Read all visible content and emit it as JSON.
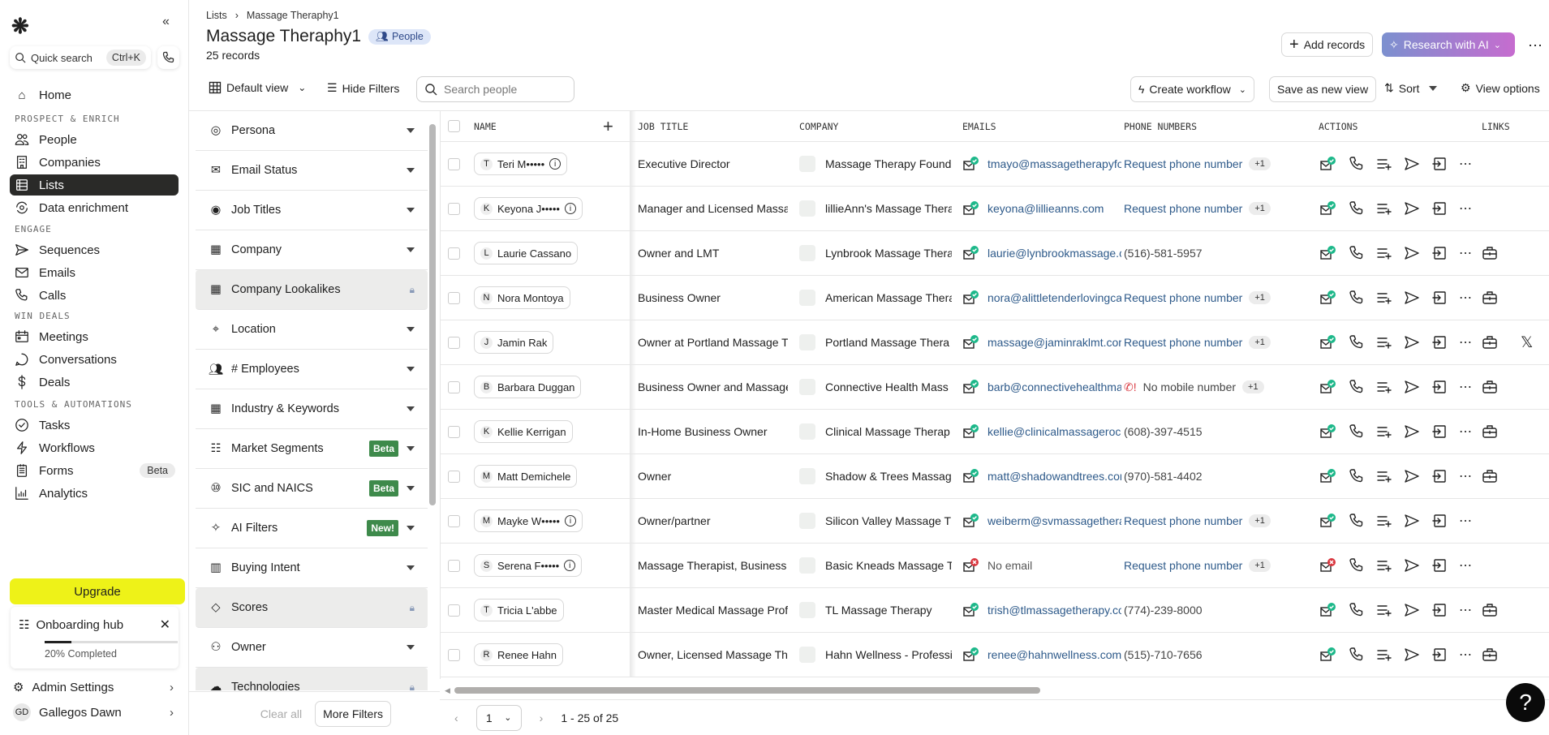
{
  "sidebar": {
    "quick_search": "Quick search",
    "shortcut": "Ctrl+K",
    "home": "Home",
    "sections": [
      {
        "label": "PROSPECT & ENRICH",
        "items": [
          {
            "label": "People",
            "icon": "people"
          },
          {
            "label": "Companies",
            "icon": "building"
          },
          {
            "label": "Lists",
            "icon": "list",
            "active": true
          },
          {
            "label": "Data enrichment",
            "icon": "refresh"
          }
        ]
      },
      {
        "label": "ENGAGE",
        "items": [
          {
            "label": "Sequences",
            "icon": "send"
          },
          {
            "label": "Emails",
            "icon": "mail"
          },
          {
            "label": "Calls",
            "icon": "phone"
          }
        ]
      },
      {
        "label": "WIN DEALS",
        "items": [
          {
            "label": "Meetings",
            "icon": "calendar"
          },
          {
            "label": "Conversations",
            "icon": "chat"
          },
          {
            "label": "Deals",
            "icon": "dollar"
          }
        ]
      },
      {
        "label": "TOOLS & AUTOMATIONS",
        "items": [
          {
            "label": "Tasks",
            "icon": "check"
          },
          {
            "label": "Workflows",
            "icon": "bolt"
          },
          {
            "label": "Forms",
            "icon": "form",
            "badge": "Beta"
          },
          {
            "label": "Analytics",
            "icon": "chart"
          }
        ]
      }
    ],
    "upgrade": "Upgrade",
    "onboarding": {
      "title": "Onboarding hub",
      "progress": 20,
      "progress_label": "20% Completed"
    },
    "admin": "Admin Settings",
    "user": {
      "initials": "GD",
      "name": "Gallegos Dawn"
    }
  },
  "header": {
    "breadcrumb": [
      "Lists",
      "Massage Theraphy1"
    ],
    "title": "Massage Theraphy1",
    "type_badge": "People",
    "record_count": "25 records",
    "add_records": "Add records",
    "research_ai": "Research with AI"
  },
  "toolbar": {
    "view": "Default view",
    "hide_filters": "Hide Filters",
    "search_placeholder": "Search people",
    "create_workflow": "Create workflow",
    "save_view": "Save as new view",
    "sort": "Sort",
    "view_options": "View options"
  },
  "filters": {
    "items": [
      {
        "label": "Persona"
      },
      {
        "label": "Email Status"
      },
      {
        "label": "Job Titles"
      },
      {
        "label": "Company"
      },
      {
        "label": "Company Lookalikes",
        "locked": true
      },
      {
        "label": "Location"
      },
      {
        "label": "# Employees"
      },
      {
        "label": "Industry & Keywords"
      },
      {
        "label": "Market Segments",
        "badge": "Beta"
      },
      {
        "label": "SIC and NAICS",
        "badge": "Beta"
      },
      {
        "label": "AI Filters",
        "badge": "New!"
      },
      {
        "label": "Buying Intent"
      },
      {
        "label": "Scores",
        "locked": true
      },
      {
        "label": "Owner"
      },
      {
        "label": "Technologies",
        "locked": true
      }
    ],
    "clear_all": "Clear all",
    "more_filters": "More Filters"
  },
  "table": {
    "columns": [
      "NAME",
      "JOB TITLE",
      "COMPANY",
      "EMAILS",
      "PHONE NUMBERS",
      "ACTIONS",
      "LINKS"
    ],
    "rows": [
      {
        "initial": "T",
        "name": "Teri M•••••",
        "masked": true,
        "job": "Executive Director",
        "company": "Massage Therapy Found",
        "email": "tmayo@massagetherapyfou",
        "email_ok": true,
        "phone": "Request phone number",
        "phone_extra": "+1",
        "links": []
      },
      {
        "initial": "K",
        "name": "Keyona J•••••",
        "masked": true,
        "job": "Manager and Licensed Massa",
        "company": "lillieAnn's Massage Thera",
        "email": "keyona@lillieanns.com",
        "email_ok": true,
        "phone": "Request phone number",
        "phone_extra": "+1",
        "links": []
      },
      {
        "initial": "L",
        "name": "Laurie Cassano",
        "job": "Owner and LMT",
        "company": "Lynbrook Massage Thera",
        "email": "laurie@lynbrookmassage.cc",
        "email_ok": true,
        "phone": "(516)-581-5957",
        "links": [
          "linkedin"
        ]
      },
      {
        "initial": "N",
        "name": "Nora Montoya",
        "job": "Business Owner",
        "company": "American Massage Thera",
        "email": "nora@alittletenderlovingcar",
        "email_ok": true,
        "phone": "Request phone number",
        "phone_extra": "+1",
        "links": [
          "linkedin"
        ]
      },
      {
        "initial": "J",
        "name": "Jamin Rak",
        "job": "Owner at Portland Massage T",
        "company": "Portland Massage Thera",
        "email": "massage@jaminraklmt.com",
        "email_ok": true,
        "phone": "Request phone number",
        "phone_extra": "+1",
        "links": [
          "linkedin",
          "x"
        ]
      },
      {
        "initial": "B",
        "name": "Barbara Duggan",
        "job": "Business Owner and Massage",
        "company": "Connective Health Mass",
        "email": "barb@connectivehealthmas",
        "email_ok": true,
        "phone": "No mobile number",
        "phone_missing": true,
        "phone_extra": "+1",
        "links": [
          "linkedin"
        ]
      },
      {
        "initial": "K",
        "name": "Kellie Kerrigan",
        "job": "In-Home Business Owner",
        "company": "Clinical Massage Therap",
        "email": "kellie@clinicalmassagerock",
        "email_ok": true,
        "phone": "(608)-397-4515",
        "links": [
          "linkedin"
        ]
      },
      {
        "initial": "M",
        "name": "Matt Demichele",
        "job": "Owner",
        "company": "Shadow & Trees Massag",
        "email": "matt@shadowandtrees.com",
        "email_ok": true,
        "phone": "(970)-581-4402",
        "links": [
          "linkedin"
        ]
      },
      {
        "initial": "M",
        "name": "Mayke W•••••",
        "masked": true,
        "job": "Owner/partner",
        "company": "Silicon Valley Massage T",
        "email": "weiberm@svmassagetherap",
        "email_ok": true,
        "phone": "Request phone number",
        "phone_extra": "+1",
        "links": []
      },
      {
        "initial": "S",
        "name": "Serena F•••••",
        "masked": true,
        "job": "Massage Therapist, Business",
        "company": "Basic Kneads Massage T",
        "email": "No email",
        "email_ok": false,
        "phone": "Request phone number",
        "phone_extra": "+1",
        "links": []
      },
      {
        "initial": "T",
        "name": "Tricia L'abbe",
        "job": "Master Medical Massage Prof",
        "company": "TL Massage Therapy",
        "email": "trish@tlmassagetherapy.cor",
        "email_ok": true,
        "phone": "(774)-239-8000",
        "links": [
          "linkedin"
        ]
      },
      {
        "initial": "R",
        "name": "Renee Hahn",
        "job": "Owner, Licensed Massage Th",
        "company": "Hahn Wellness - Professi",
        "email": "renee@hahnwellness.com",
        "email_ok": true,
        "phone": "(515)-710-7656",
        "links": [
          "linkedin"
        ]
      }
    ]
  },
  "pagination": {
    "page": "1",
    "range": "1 - 25 of 25"
  },
  "colors": {
    "accent_dark": "#2a2a28",
    "upgrade": "#eef218",
    "link_blue": "#2e5a8a",
    "badge_green": "#3e8a4b",
    "ok_green": "#1db88a",
    "error_red": "#d9363e"
  },
  "help": "?"
}
